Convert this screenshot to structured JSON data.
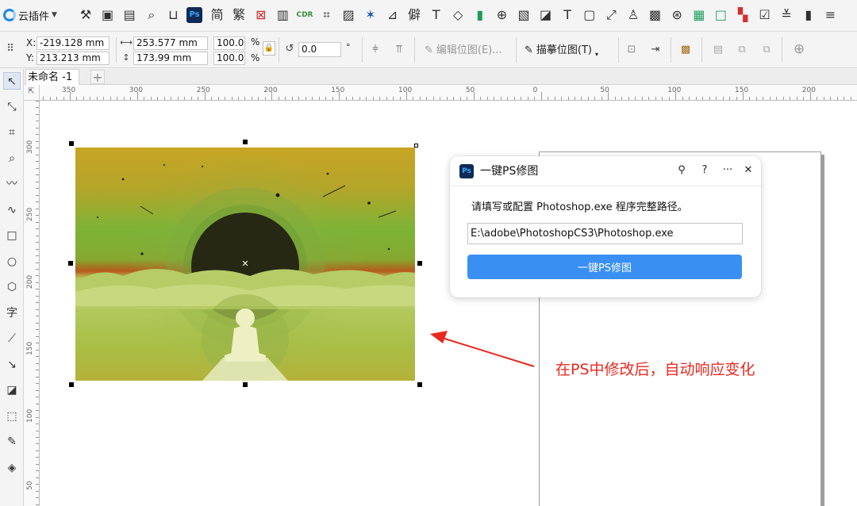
{
  "app": {
    "plugin_menu_label": "云插件",
    "document_tab": "未命名 -1",
    "new_tab_symbol": "+"
  },
  "toolbar_icons": [
    {
      "name": "wrench-icon",
      "glyph": "⚒"
    },
    {
      "name": "image-check-icon",
      "glyph": "▣"
    },
    {
      "name": "table-icon",
      "glyph": "▤"
    },
    {
      "name": "search-doc-icon",
      "glyph": "⌕"
    },
    {
      "name": "cup-icon",
      "glyph": "⊔"
    },
    {
      "name": "photoshop-icon",
      "glyph": "Ps"
    },
    {
      "name": "simplified-chinese-icon",
      "glyph": "简"
    },
    {
      "name": "traditional-chinese-icon",
      "glyph": "繁"
    },
    {
      "name": "delete-frame-icon",
      "glyph": "⊠"
    },
    {
      "name": "column-icon",
      "glyph": "▥"
    },
    {
      "name": "cdr-icon",
      "glyph": "CDR"
    },
    {
      "name": "crop-frame-icon",
      "glyph": "⌗"
    },
    {
      "name": "picture-icon",
      "glyph": "▨"
    },
    {
      "name": "star-transform-icon",
      "glyph": "✶"
    },
    {
      "name": "chart-icon",
      "glyph": "⊿"
    },
    {
      "name": "rare-char-icon",
      "glyph": "僻"
    },
    {
      "name": "text-format-icon",
      "glyph": "T"
    },
    {
      "name": "shape-node-icon",
      "glyph": "◇"
    },
    {
      "name": "bookmark-green-icon",
      "glyph": "▮"
    },
    {
      "name": "globe-icon",
      "glyph": "⊕"
    },
    {
      "name": "picture-frame-icon",
      "glyph": "▧"
    },
    {
      "name": "image-edit-icon",
      "glyph": "◪"
    },
    {
      "name": "text-tool-icon",
      "glyph": "T"
    },
    {
      "name": "speech-icon",
      "glyph": "▢"
    },
    {
      "name": "expand-icon",
      "glyph": "⤢"
    },
    {
      "name": "person-icon",
      "glyph": "♙"
    },
    {
      "name": "gallery-icon",
      "glyph": "▩"
    },
    {
      "name": "badge-icon",
      "glyph": "⊛"
    },
    {
      "name": "grid-icon",
      "glyph": "▦"
    },
    {
      "name": "square-icon",
      "glyph": "□"
    },
    {
      "name": "pixel-icon",
      "glyph": "▚"
    },
    {
      "name": "checkbox-icon",
      "glyph": "☑"
    },
    {
      "name": "sliders-icon",
      "glyph": "≚"
    },
    {
      "name": "book-icon",
      "glyph": "▮"
    },
    {
      "name": "list-icon",
      "glyph": "≡"
    }
  ],
  "property_bar": {
    "x_label": "X:",
    "x_value": "-219.128 mm",
    "y_label": "Y:",
    "y_value": "213.213 mm",
    "width_value": "253.577 mm",
    "height_value": "173.99 mm",
    "scale_w": "100.0",
    "scale_h": "100.0",
    "percent_symbol": "%",
    "rotation_value": "0.0",
    "degree_symbol": "°",
    "edit_bitmap_label": "编辑位图(E)...",
    "trace_bitmap_label": "描摹位图(T)"
  },
  "toolbox_icons": [
    "pick-tool-icon",
    "shape-tool-icon",
    "crop-tool-icon",
    "zoom-tool-icon",
    "freehand-tool-icon",
    "artistic-media-icon",
    "rectangle-tool-icon",
    "ellipse-tool-icon",
    "polygon-tool-icon",
    "text-tool-icon",
    "parallel-dimension-icon",
    "connector-tool-icon",
    "shadow-tool-icon",
    "transparency-tool-icon",
    "eyedropper-tool-icon",
    "fill-tool-icon"
  ],
  "toolbox_glyphs": [
    "↖",
    "⤡",
    "⌗",
    "⌕",
    "〰",
    "∿",
    "□",
    "○",
    "⬡",
    "字",
    "⟋",
    "↘",
    "◪",
    "⬚",
    "✎",
    "◈"
  ],
  "ruler": {
    "h_labels": [
      "350",
      "300",
      "250",
      "200",
      "150",
      "100",
      "50",
      "0",
      "50",
      "100",
      "150",
      "200"
    ],
    "v_labels": [
      "300",
      "250",
      "200",
      "150",
      "100",
      "50"
    ],
    "corner_symbol": "⇱"
  },
  "dialog": {
    "title": "一键PS修图",
    "icon_text": "Ps",
    "pin_symbol": "⚲",
    "help_symbol": "?",
    "more_symbol": "···",
    "close_symbol": "✕",
    "prompt": "请填写或配置 Photoshop.exe 程序完整路径。",
    "path_value": "E:\\adobe\\PhotoshopCS3\\Photoshop.exe",
    "run_button": "一键PS修图"
  },
  "annotation": {
    "text": "在PS中修改后，自动响应变化",
    "color": "#e8291f"
  },
  "colors": {
    "accent": "#3a8ff3",
    "photoshop_bg": "#0f2a56",
    "photoshop_fg": "#31a8ff"
  }
}
